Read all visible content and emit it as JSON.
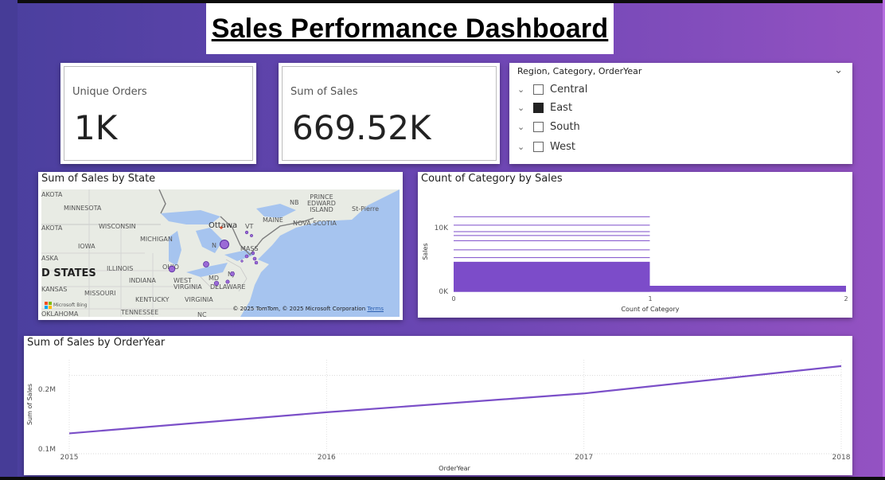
{
  "title": "Sales Performance Dashboard",
  "kpis": {
    "unique_orders": {
      "label": "Unique Orders",
      "value": "1K"
    },
    "sum_of_sales": {
      "label": "Sum of Sales",
      "value": "669.52K"
    }
  },
  "slicer": {
    "header": "Region, Category, OrderYear",
    "items": [
      {
        "label": "Central",
        "checked": false
      },
      {
        "label": "East",
        "checked": true
      },
      {
        "label": "South",
        "checked": false
      },
      {
        "label": "West",
        "checked": false
      }
    ]
  },
  "map": {
    "title": "Sum of Sales by State",
    "labels": {
      "akota1": "AKOTA",
      "minnesota": "MINNESOTA",
      "akota2": "AKOTA",
      "wisconsin": "WISCONSIN",
      "michigan": "MICHIGAN",
      "iowa": "IOWA",
      "aska": "ASKA",
      "illinois": "ILLINOIS",
      "ohio": "OHIO",
      "indiana": "INDIANA",
      "states": "D STATES",
      "kansas": "KANSAS",
      "missouri": "MISSOURI",
      "west_virginia": "WEST\nVIRGINIA",
      "kentucky": "KENTUCKY",
      "virginia": "VIRGINIA",
      "tennessee": "TENNESSEE",
      "oklahoma": "OKLAHOMA",
      "nc": "NC",
      "ottawa": "Ottawa",
      "n": "N",
      "vt": "VT",
      "maine": "MAINE",
      "mass": "MASS",
      "md": "MD",
      "nj": "NJ",
      "delaware": "DELAWARE",
      "nb": "NB",
      "pei": "PRINCE\nEDWARD\nISLAND",
      "st_pierre": "St-Pierre",
      "nova_scotia": "NOVA SCOTIA"
    },
    "copyright": "© 2025 TomTom, © 2025 Microsoft Corporation",
    "terms": "Terms",
    "logo_text": "Microsoft Bing"
  },
  "bar_chart": {
    "title": "Count of Category by Sales",
    "y_ticks": [
      "10K",
      "0K"
    ],
    "x_ticks": [
      "0",
      "1",
      "2"
    ],
    "xlabel": "Count of Category",
    "ylabel": "Sales",
    "color": "#7c4cc9"
  },
  "line_chart": {
    "title": "Sum of Sales by OrderYear",
    "y_ticks": [
      "0.2M",
      "0.1M"
    ],
    "xlabel": "OrderYear",
    "ylabel": "Sum of Sales",
    "color": "#7b4fc8"
  },
  "chart_data": [
    {
      "type": "line",
      "title": "Sum of Sales by OrderYear",
      "xlabel": "OrderYear",
      "ylabel": "Sum of Sales",
      "x": [
        2015,
        2016,
        2017,
        2018
      ],
      "values": [
        126000,
        153000,
        177000,
        212000
      ],
      "ylim": [
        100000,
        220000
      ],
      "grid": true
    },
    {
      "type": "bar",
      "title": "Count of Category by Sales",
      "xlabel": "Count of Category",
      "ylabel": "Sales",
      "xlim": [
        0,
        2
      ],
      "ylim": [
        0,
        13000
      ],
      "note_groups": [
        {
          "count": 1,
          "sales_max": 11500
        },
        {
          "count": 2,
          "sales_max": 800
        }
      ]
    }
  ]
}
